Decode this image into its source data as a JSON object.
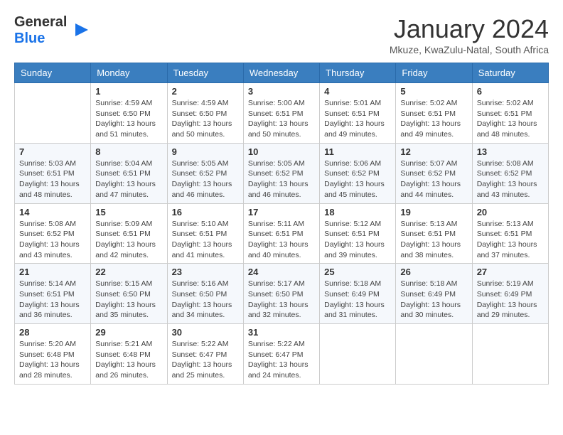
{
  "header": {
    "logo_general": "General",
    "logo_blue": "Blue",
    "title": "January 2024",
    "subtitle": "Mkuze, KwaZulu-Natal, South Africa"
  },
  "days_of_week": [
    "Sunday",
    "Monday",
    "Tuesday",
    "Wednesday",
    "Thursday",
    "Friday",
    "Saturday"
  ],
  "weeks": [
    [
      {
        "day": "",
        "info": ""
      },
      {
        "day": "1",
        "info": "Sunrise: 4:59 AM\nSunset: 6:50 PM\nDaylight: 13 hours\nand 51 minutes."
      },
      {
        "day": "2",
        "info": "Sunrise: 4:59 AM\nSunset: 6:50 PM\nDaylight: 13 hours\nand 50 minutes."
      },
      {
        "day": "3",
        "info": "Sunrise: 5:00 AM\nSunset: 6:51 PM\nDaylight: 13 hours\nand 50 minutes."
      },
      {
        "day": "4",
        "info": "Sunrise: 5:01 AM\nSunset: 6:51 PM\nDaylight: 13 hours\nand 49 minutes."
      },
      {
        "day": "5",
        "info": "Sunrise: 5:02 AM\nSunset: 6:51 PM\nDaylight: 13 hours\nand 49 minutes."
      },
      {
        "day": "6",
        "info": "Sunrise: 5:02 AM\nSunset: 6:51 PM\nDaylight: 13 hours\nand 48 minutes."
      }
    ],
    [
      {
        "day": "7",
        "info": "Sunrise: 5:03 AM\nSunset: 6:51 PM\nDaylight: 13 hours\nand 48 minutes."
      },
      {
        "day": "8",
        "info": "Sunrise: 5:04 AM\nSunset: 6:51 PM\nDaylight: 13 hours\nand 47 minutes."
      },
      {
        "day": "9",
        "info": "Sunrise: 5:05 AM\nSunset: 6:52 PM\nDaylight: 13 hours\nand 46 minutes."
      },
      {
        "day": "10",
        "info": "Sunrise: 5:05 AM\nSunset: 6:52 PM\nDaylight: 13 hours\nand 46 minutes."
      },
      {
        "day": "11",
        "info": "Sunrise: 5:06 AM\nSunset: 6:52 PM\nDaylight: 13 hours\nand 45 minutes."
      },
      {
        "day": "12",
        "info": "Sunrise: 5:07 AM\nSunset: 6:52 PM\nDaylight: 13 hours\nand 44 minutes."
      },
      {
        "day": "13",
        "info": "Sunrise: 5:08 AM\nSunset: 6:52 PM\nDaylight: 13 hours\nand 43 minutes."
      }
    ],
    [
      {
        "day": "14",
        "info": "Sunrise: 5:08 AM\nSunset: 6:52 PM\nDaylight: 13 hours\nand 43 minutes."
      },
      {
        "day": "15",
        "info": "Sunrise: 5:09 AM\nSunset: 6:51 PM\nDaylight: 13 hours\nand 42 minutes."
      },
      {
        "day": "16",
        "info": "Sunrise: 5:10 AM\nSunset: 6:51 PM\nDaylight: 13 hours\nand 41 minutes."
      },
      {
        "day": "17",
        "info": "Sunrise: 5:11 AM\nSunset: 6:51 PM\nDaylight: 13 hours\nand 40 minutes."
      },
      {
        "day": "18",
        "info": "Sunrise: 5:12 AM\nSunset: 6:51 PM\nDaylight: 13 hours\nand 39 minutes."
      },
      {
        "day": "19",
        "info": "Sunrise: 5:13 AM\nSunset: 6:51 PM\nDaylight: 13 hours\nand 38 minutes."
      },
      {
        "day": "20",
        "info": "Sunrise: 5:13 AM\nSunset: 6:51 PM\nDaylight: 13 hours\nand 37 minutes."
      }
    ],
    [
      {
        "day": "21",
        "info": "Sunrise: 5:14 AM\nSunset: 6:51 PM\nDaylight: 13 hours\nand 36 minutes."
      },
      {
        "day": "22",
        "info": "Sunrise: 5:15 AM\nSunset: 6:50 PM\nDaylight: 13 hours\nand 35 minutes."
      },
      {
        "day": "23",
        "info": "Sunrise: 5:16 AM\nSunset: 6:50 PM\nDaylight: 13 hours\nand 34 minutes."
      },
      {
        "day": "24",
        "info": "Sunrise: 5:17 AM\nSunset: 6:50 PM\nDaylight: 13 hours\nand 32 minutes."
      },
      {
        "day": "25",
        "info": "Sunrise: 5:18 AM\nSunset: 6:49 PM\nDaylight: 13 hours\nand 31 minutes."
      },
      {
        "day": "26",
        "info": "Sunrise: 5:18 AM\nSunset: 6:49 PM\nDaylight: 13 hours\nand 30 minutes."
      },
      {
        "day": "27",
        "info": "Sunrise: 5:19 AM\nSunset: 6:49 PM\nDaylight: 13 hours\nand 29 minutes."
      }
    ],
    [
      {
        "day": "28",
        "info": "Sunrise: 5:20 AM\nSunset: 6:48 PM\nDaylight: 13 hours\nand 28 minutes."
      },
      {
        "day": "29",
        "info": "Sunrise: 5:21 AM\nSunset: 6:48 PM\nDaylight: 13 hours\nand 26 minutes."
      },
      {
        "day": "30",
        "info": "Sunrise: 5:22 AM\nSunset: 6:47 PM\nDaylight: 13 hours\nand 25 minutes."
      },
      {
        "day": "31",
        "info": "Sunrise: 5:22 AM\nSunset: 6:47 PM\nDaylight: 13 hours\nand 24 minutes."
      },
      {
        "day": "",
        "info": ""
      },
      {
        "day": "",
        "info": ""
      },
      {
        "day": "",
        "info": ""
      }
    ]
  ]
}
